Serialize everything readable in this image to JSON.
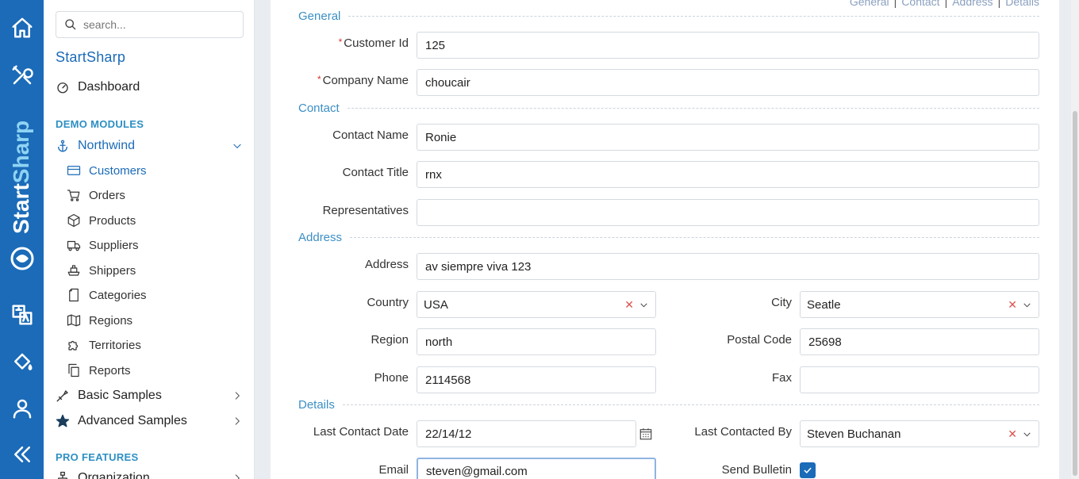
{
  "brand": {
    "name": "StartSharp",
    "accent": "#1b6bb8"
  },
  "rail": {
    "icons": [
      "home-icon",
      "tools-icon",
      "language-icon",
      "paint-bucket-icon",
      "user-icon",
      "collapse-icon"
    ]
  },
  "sidebar": {
    "search_placeholder": "search...",
    "app_title": "StartSharp",
    "dashboard": "Dashboard",
    "demo_header": "DEMO MODULES",
    "northwind": "Northwind",
    "items": [
      {
        "label": "Customers",
        "icon": "card-icon",
        "active": true
      },
      {
        "label": "Orders",
        "icon": "cart-icon"
      },
      {
        "label": "Products",
        "icon": "box-icon"
      },
      {
        "label": "Suppliers",
        "icon": "truck-icon"
      },
      {
        "label": "Shippers",
        "icon": "ship-icon"
      },
      {
        "label": "Categories",
        "icon": "page-icon"
      },
      {
        "label": "Regions",
        "icon": "map-icon"
      },
      {
        "label": "Territories",
        "icon": "puzzle-icon"
      },
      {
        "label": "Reports",
        "icon": "copy-icon"
      }
    ],
    "basic_samples": "Basic Samples",
    "advanced_samples": "Advanced Samples",
    "pro_header": "PRO FEATURES",
    "organization": "Organization"
  },
  "toplinks": [
    "General",
    "Contact",
    "Address",
    "Details"
  ],
  "form": {
    "categories": {
      "general": "General",
      "contact": "Contact",
      "address": "Address",
      "details": "Details"
    },
    "customer_id": {
      "label": "Customer Id",
      "value": "125",
      "required": true
    },
    "company_name": {
      "label": "Company Name",
      "value": "choucair",
      "required": true
    },
    "contact_name": {
      "label": "Contact Name",
      "value": "Ronie"
    },
    "contact_title": {
      "label": "Contact Title",
      "value": "rnx"
    },
    "representatives": {
      "label": "Representatives",
      "value": ""
    },
    "address": {
      "label": "Address",
      "value": "av siempre viva 123"
    },
    "country": {
      "label": "Country",
      "value": "USA"
    },
    "city": {
      "label": "City",
      "value": "Seatle"
    },
    "region": {
      "label": "Region",
      "value": "north"
    },
    "postal_code": {
      "label": "Postal Code",
      "value": "25698"
    },
    "phone": {
      "label": "Phone",
      "value": "2114568"
    },
    "fax": {
      "label": "Fax",
      "value": ""
    },
    "last_contact_date": {
      "label": "Last Contact Date",
      "value": "22/14/12"
    },
    "last_contacted_by": {
      "label": "Last Contacted By",
      "value": "Steven Buchanan"
    },
    "email": {
      "label": "Email",
      "value": "steven@gmail.com"
    },
    "send_bulletin": {
      "label": "Send Bulletin",
      "checked": true
    }
  }
}
